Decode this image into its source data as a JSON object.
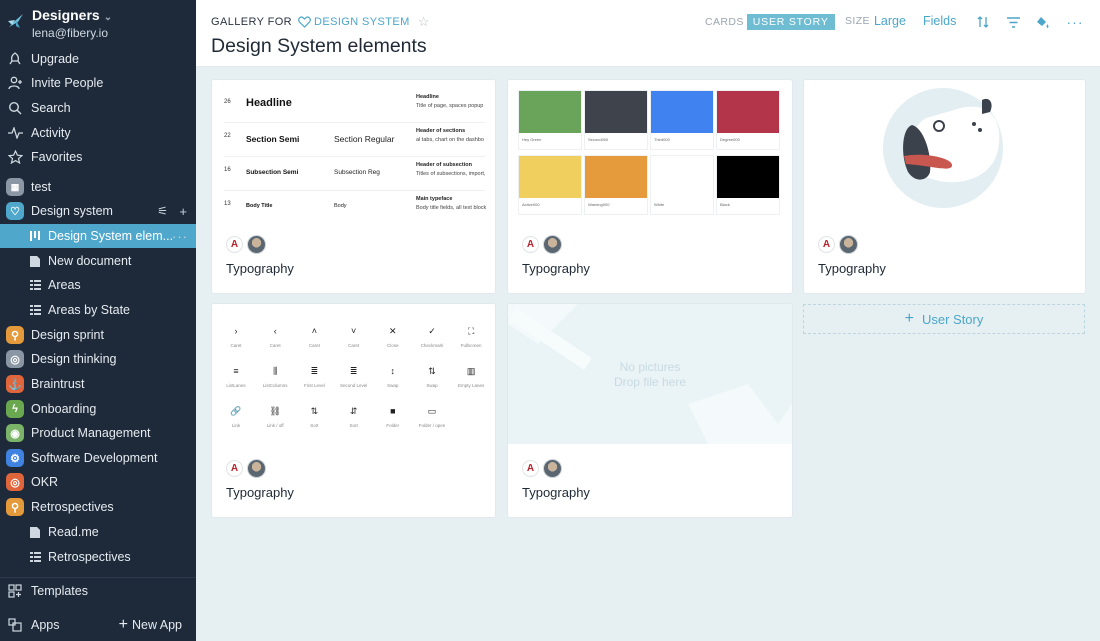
{
  "workspace": {
    "name": "Designers",
    "email": "lena@fibery.io"
  },
  "sidebar": {
    "top_items": [
      {
        "label": "Upgrade",
        "icon": "rocket-icon"
      },
      {
        "label": "Invite People",
        "icon": "invite-icon"
      },
      {
        "label": "Search",
        "icon": "search-icon"
      },
      {
        "label": "Activity",
        "icon": "activity-icon"
      },
      {
        "label": "Favorites",
        "icon": "star-icon"
      }
    ],
    "spaces": [
      {
        "label": "test"
      },
      {
        "label": "Design system"
      },
      {
        "label": "Design System elem...",
        "active": true
      },
      {
        "label": "New document"
      },
      {
        "label": "Areas"
      },
      {
        "label": "Areas by State"
      },
      {
        "label": "Design sprint"
      },
      {
        "label": "Design thinking"
      },
      {
        "label": "Braintrust"
      },
      {
        "label": "Onboarding"
      },
      {
        "label": "Product Management"
      },
      {
        "label": "Software Development"
      },
      {
        "label": "OKR"
      },
      {
        "label": "Retrospectives"
      },
      {
        "label": "Read.me"
      },
      {
        "label": "Retrospectives"
      }
    ],
    "templates_label": "Templates",
    "apps_label": "Apps",
    "new_app_label": "New App"
  },
  "header": {
    "gallery_for": "GALLERY FOR",
    "database": "DESIGN SYSTEM",
    "title": "Design System elements",
    "cards_label": "CARDS",
    "cards_value": "USER STORY",
    "size_label": "SIZE",
    "size_value": "Large",
    "fields_label": "Fields"
  },
  "cards": [
    {
      "title": "Typography"
    },
    {
      "title": "Typography"
    },
    {
      "title": "Typography"
    },
    {
      "title": "Typography"
    },
    {
      "title": "Typography"
    }
  ],
  "typography_preview": [
    {
      "size": "26",
      "name": "Headline",
      "regular": "",
      "head": "Headline",
      "desc": "Title of page, spaces popup"
    },
    {
      "size": "22",
      "name": "Section Semi",
      "regular": "Section Regular",
      "head": "Header of sections",
      "desc": "al tabs, chart on the dashbo"
    },
    {
      "size": "16",
      "name": "Subsection Semi",
      "regular": "Subsection Reg",
      "head": "Header of subsection",
      "desc": "Titles of subsections, import,"
    },
    {
      "size": "13",
      "name": "Body Title",
      "regular": "Body",
      "head": "Main typeface",
      "desc": "Body title fields, all text block"
    }
  ],
  "color_swatches": [
    {
      "label": "Hey Green",
      "color": "#6aa35a"
    },
    {
      "label": "Second000",
      "color": "#3e434c"
    },
    {
      "label": "Third000",
      "color": "#3f82f0"
    },
    {
      "label": "Degree000",
      "color": "#b33549"
    },
    {
      "label": "Active000",
      "color": "#f0cf5e"
    },
    {
      "label": "Warning000",
      "color": "#e59a3b"
    },
    {
      "label": "White",
      "color": "#ffffff"
    },
    {
      "label": "Black",
      "color": "#000000"
    }
  ],
  "icon_preview": [
    {
      "glyph": "›",
      "label": "Caret"
    },
    {
      "glyph": "‹",
      "label": "Caret"
    },
    {
      "glyph": "˄",
      "label": "Caret"
    },
    {
      "glyph": "˅",
      "label": "Caret"
    },
    {
      "glyph": "✕",
      "label": "Close"
    },
    {
      "glyph": "✓",
      "label": "Checkmark"
    },
    {
      "glyph": "⛶",
      "label": "Fullscreen"
    },
    {
      "glyph": "≡",
      "label": "ListLanes"
    },
    {
      "glyph": "⫼",
      "label": "ListColumns"
    },
    {
      "glyph": "≣",
      "label": "First Level"
    },
    {
      "glyph": "≣",
      "label": "Second Level"
    },
    {
      "glyph": "↕",
      "label": "Swap"
    },
    {
      "glyph": "⇅",
      "label": "Swap"
    },
    {
      "glyph": "▥",
      "label": "Empty Lanes"
    },
    {
      "glyph": "🔗",
      "label": "Link"
    },
    {
      "glyph": "⛓",
      "label": "Link / off"
    },
    {
      "glyph": "⇅",
      "label": "Sort"
    },
    {
      "glyph": "⇵",
      "label": "Sort"
    },
    {
      "glyph": "■",
      "label": "Folder"
    },
    {
      "glyph": "▭",
      "label": "Folder / open"
    }
  ],
  "empty_cover": {
    "line1": "No pictures",
    "line2": "Drop file here"
  },
  "add_card_label": "User Story",
  "colors": {
    "sidebar_bg": "#1e2a3a",
    "accent": "#4ba6c9",
    "canvas": "#e6f0f3"
  }
}
